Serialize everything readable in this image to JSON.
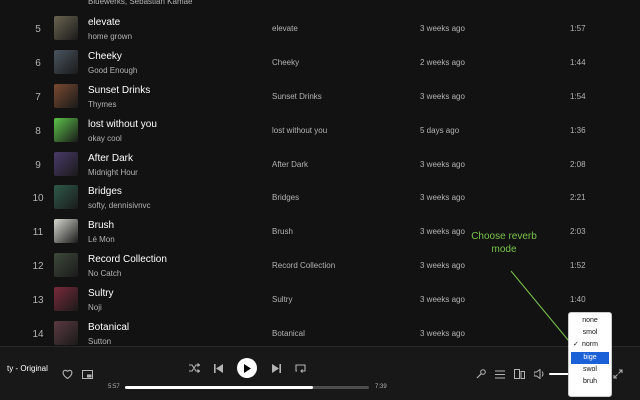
{
  "tracks": [
    {
      "num": "",
      "title": "",
      "artist": "Bluewerks, Sebastian Kamae",
      "album": "",
      "added": "",
      "duration": "",
      "art_color": "#3a3a3a"
    },
    {
      "num": "5",
      "title": "elevate",
      "artist": "home grown",
      "album": "elevate",
      "added": "3 weeks ago",
      "duration": "1:57",
      "art_color": "#6a6450"
    },
    {
      "num": "6",
      "title": "Cheeky",
      "artist": "Good Enough",
      "album": "Cheeky",
      "added": "2 weeks ago",
      "duration": "1:44",
      "art_color": "#4a5560"
    },
    {
      "num": "7",
      "title": "Sunset Drinks",
      "artist": "Thymes",
      "album": "Sunset Drinks",
      "added": "3 weeks ago",
      "duration": "1:54",
      "art_color": "#7a4a30"
    },
    {
      "num": "8",
      "title": "lost without you",
      "artist": "okay cool",
      "album": "lost without you",
      "added": "5 days ago",
      "duration": "1:36",
      "art_color": "#5cc24a"
    },
    {
      "num": "9",
      "title": "After Dark",
      "artist": "Midnight Hour",
      "album": "After Dark",
      "added": "3 weeks ago",
      "duration": "2:08",
      "art_color": "#4a3a6a"
    },
    {
      "num": "10",
      "title": "Bridges",
      "artist": "softy, dennisivnvc",
      "album": "Bridges",
      "added": "3 weeks ago",
      "duration": "2:21",
      "art_color": "#2e5a4a"
    },
    {
      "num": "11",
      "title": "Brush",
      "artist": "Lé Mon",
      "album": "Brush",
      "added": "3 weeks ago",
      "duration": "2:03",
      "art_color": "#d8d8d0"
    },
    {
      "num": "12",
      "title": "Record Collection",
      "artist": "No Catch",
      "album": "Record Collection",
      "added": "3 weeks ago",
      "duration": "1:52",
      "art_color": "#3e4a3a"
    },
    {
      "num": "13",
      "title": "Sultry",
      "artist": "Noji",
      "album": "Sultry",
      "added": "3 weeks ago",
      "duration": "1:40",
      "art_color": "#7a2a3a"
    },
    {
      "num": "14",
      "title": "Botanical",
      "artist": "Sutton",
      "album": "Botanical",
      "added": "3 weeks ago",
      "duration": "",
      "art_color": "#5a3a40"
    }
  ],
  "player": {
    "now_playing": "ty - Original",
    "time_current": "5:57",
    "time_total": "7:39",
    "progress": 0.77
  },
  "reverb_menu": {
    "options": [
      "none",
      "smol",
      "norm",
      "bige",
      "swol",
      "bruh"
    ],
    "checked": "norm",
    "highlighted": "bige",
    "check_mark": "✓"
  },
  "annotation": {
    "text": "Choose reverb mode",
    "color": "#79c34a"
  },
  "icons": {
    "heart": "heart-icon",
    "pip": "picture-in-picture-icon",
    "shuffle": "shuffle-icon",
    "previous": "skip-back-icon",
    "play": "play-icon",
    "next": "skip-forward-icon",
    "repeat": "repeat-icon",
    "lyrics": "microphone-icon",
    "queue": "queue-icon",
    "devices": "devices-icon",
    "volume": "volume-icon",
    "fullscreen": "fullscreen-icon"
  }
}
